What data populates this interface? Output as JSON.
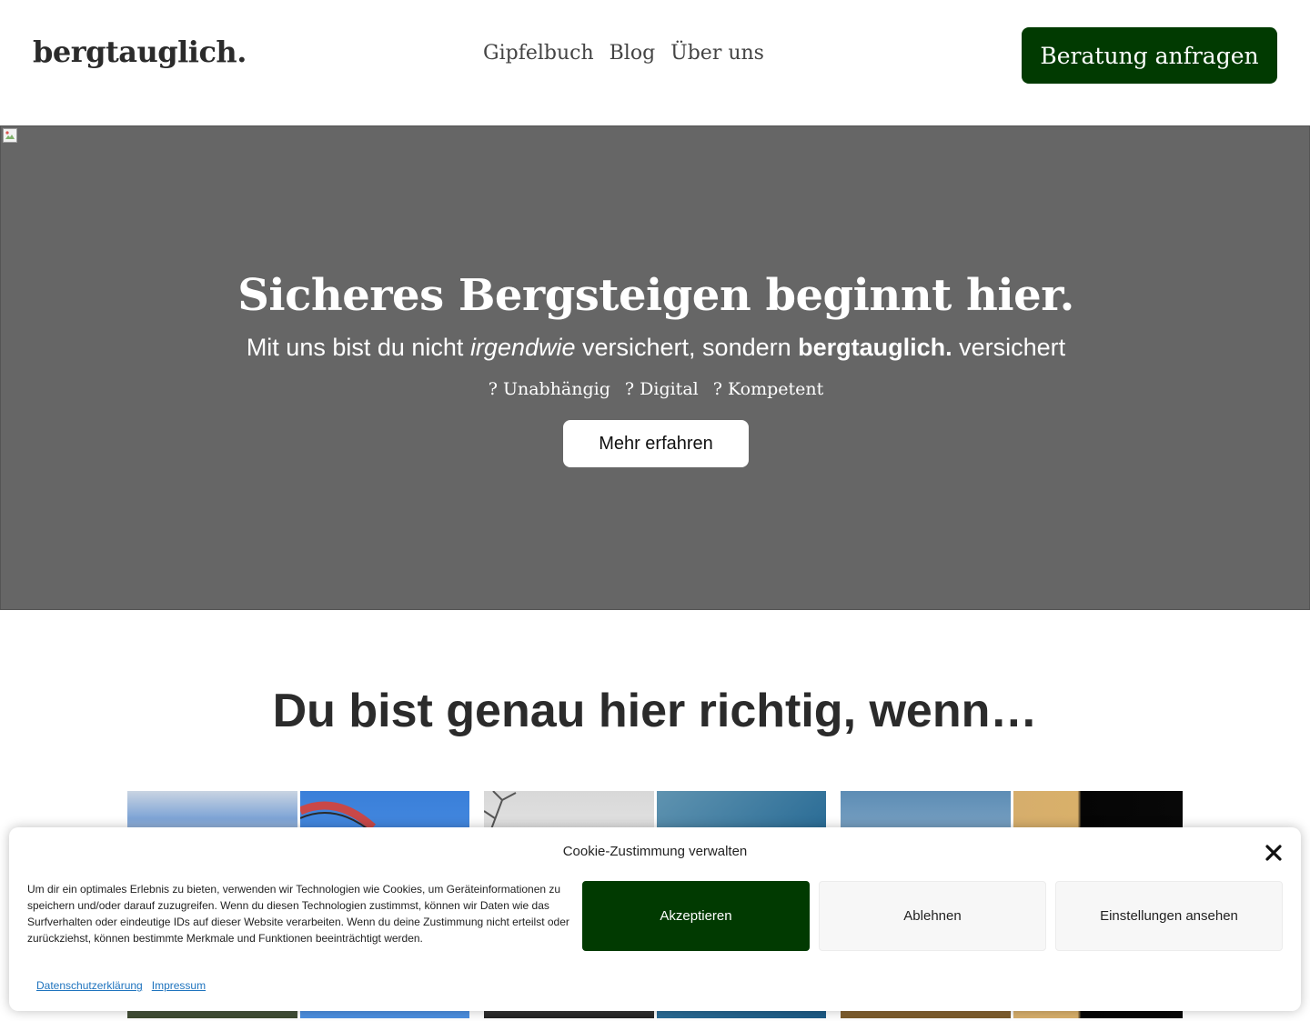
{
  "header": {
    "logo": "bergtauglich.",
    "nav": [
      "Gipfelbuch",
      "Blog",
      "Über uns"
    ],
    "cta": "Beratung anfragen"
  },
  "hero": {
    "title": "Sicheres Bergsteigen beginnt hier.",
    "subtitle_pre": "Mit uns bist du nicht ",
    "subtitle_em": "irgendwie",
    "subtitle_mid": " versichert, sondern ",
    "subtitle_strong": "bergtauglich.",
    "subtitle_post": " versichert",
    "features": [
      "? Unabhängig",
      "? Digital",
      "? Kompetent"
    ],
    "button": "Mehr erfahren"
  },
  "section": {
    "title": "Du bist genau hier richtig, wenn…"
  },
  "cookie": {
    "title": "Cookie-Zustimmung verwalten",
    "text": "Um dir ein optimales Erlebnis zu bieten, verwenden wir Technologien wie Cookies, um Geräteinformationen zu speichern und/oder darauf zuzugreifen. Wenn du diesen Technologien zustimmst, können wir Daten wie das Surfverhalten oder eindeutige IDs auf dieser Website verarbeiten. Wenn du deine Zustimmung nicht erteilst oder zurückziehst, können bestimmte Merkmale und Funktionen beeinträchtigt werden.",
    "accept": "Akzeptieren",
    "deny": "Ablehnen",
    "settings": "Einstellungen ansehen",
    "links": [
      "Datenschutzerklärung",
      "Impressum"
    ]
  },
  "colors": {
    "brand_green": "#013a01",
    "hero_bg": "#666666",
    "link_blue": "#1e73be"
  },
  "icons": {
    "close": "close-icon",
    "broken_image": "broken-image-icon"
  }
}
